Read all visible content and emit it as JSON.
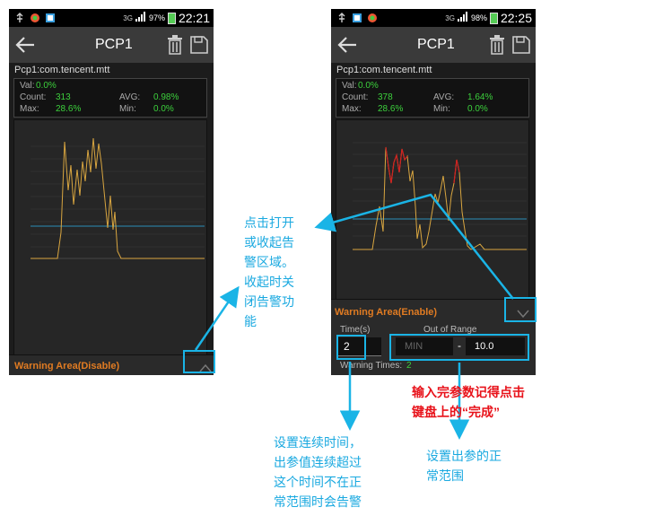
{
  "left_phone": {
    "status_bar": {
      "network": "3G",
      "battery": "97%",
      "time": "22:21"
    },
    "title": "PCP1",
    "package": "Pcp1:com.tencent.mtt",
    "stats": {
      "val_label": "Val:",
      "val": "0.0%",
      "count_label": "Count:",
      "count": "313",
      "avg_label": "AVG:",
      "avg": "0.98%",
      "max_label": "Max:",
      "max": "28.6%",
      "min_label": "Min:",
      "min": "0.0%"
    },
    "warning_area": "Warning Area(Disable)"
  },
  "right_phone": {
    "status_bar": {
      "network": "3G",
      "battery": "98%",
      "time": "22:25"
    },
    "title": "PCP1",
    "package": "Pcp1:com.tencent.mtt",
    "stats": {
      "val_label": "Val:",
      "val": "0.0%",
      "count_label": "Count:",
      "count": "378",
      "avg_label": "AVG:",
      "avg": "1.64%",
      "max_label": "Max:",
      "max": "28.6%",
      "min_label": "Min:",
      "min": "0.0%"
    },
    "warning_area": "Warning Area(Enable)",
    "time_label": "Time(s)",
    "time_value": "2",
    "range_label": "Out of Range",
    "min_placeholder": "MIN",
    "range_dash": "-",
    "max_value": "10.0",
    "warning_times_label": "Warning Times:",
    "warning_times": "2"
  },
  "annotations": {
    "toggle_note": [
      "点击打开",
      "或收起告",
      "警区域。",
      "收起时关",
      "闭告警功",
      "能"
    ],
    "time_note": [
      "设置连续时间，",
      "出参值连续超过",
      "这个时间不在正",
      "常范围时会告警"
    ],
    "keyboard_note": [
      "输入完参数记得点击",
      "键盘上的“完成”"
    ],
    "range_note": [
      "设置出参的正",
      "常范围"
    ]
  },
  "colors": {
    "series": "#d9a640",
    "alert": "#d02020",
    "threshold": "#2a8fb8",
    "accent": "#1ab4e6",
    "warning": "#e07b22",
    "value": "#3cd03c"
  }
}
